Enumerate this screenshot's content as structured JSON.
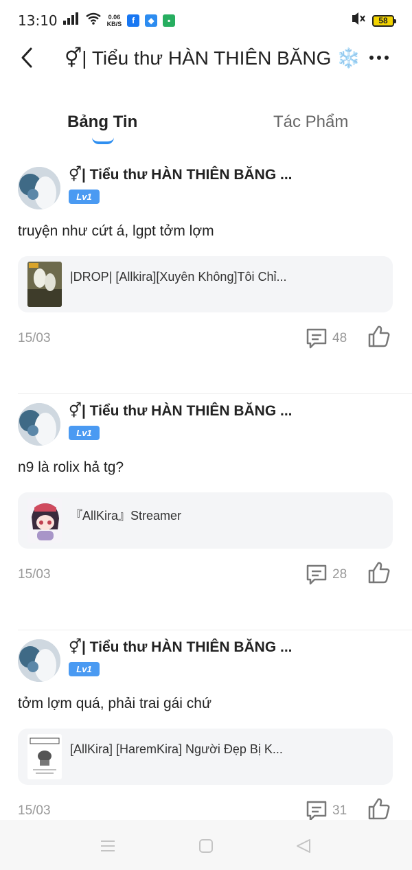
{
  "status_bar": {
    "time": "13:10",
    "speed_value": "0.06",
    "speed_unit": "KB/S",
    "battery": "58"
  },
  "header": {
    "title": "⚥| Tiểu thư HÀN THIÊN BĂNG ❄️"
  },
  "tabs": [
    {
      "label": "Bảng Tin"
    },
    {
      "label": "Tác Phẩm"
    }
  ],
  "posts": [
    {
      "author": "⚥| Tiểu thư HÀN THIÊN BĂNG ...",
      "level": "Lv1",
      "text": "truyện như cứt á, lgpt tởm lợm",
      "card_title": "|DROP| [Allkira][Xuyên Không]Tôi Chỉ...",
      "date": "15/03",
      "comments": "48"
    },
    {
      "author": "⚥| Tiểu thư HÀN THIÊN BĂNG ...",
      "level": "Lv1",
      "text": "n9 là rolix hả tg?",
      "card_title": "『AllKira』Streamer",
      "date": "15/03",
      "comments": "28"
    },
    {
      "author": "⚥| Tiểu thư HÀN THIÊN BĂNG ...",
      "level": "Lv1",
      "text": "tởm lợm quá, phải trai gái chứ",
      "card_title": "[AllKira] [HaremKira] Người Đẹp Bị K...",
      "date": "15/03",
      "comments": "31"
    }
  ],
  "colors": {
    "accent": "#2f8ff0",
    "badge": "#4a9af2",
    "muted": "#999999"
  }
}
